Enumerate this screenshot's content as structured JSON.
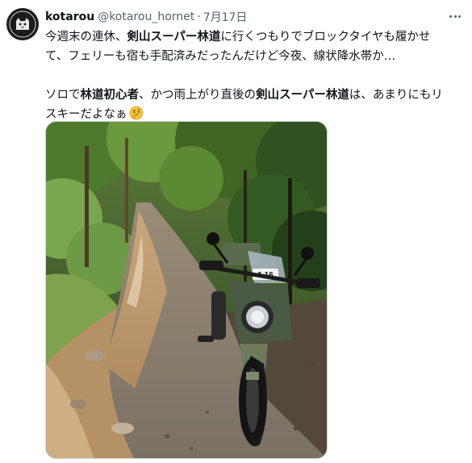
{
  "tweet": {
    "author_name": "kotarou",
    "handle": "@kotarou_hornet",
    "separator": "·",
    "date": "7月17日",
    "avatar_icon": "cat-logo-avatar",
    "more_icon": "more-options-icon",
    "paragraph1": {
      "l1a": "今週末の連休、",
      "l1b": "剣山スーパー林道",
      "l1c": "に行くつもりでブロックタイヤも履かせ",
      "l2": "て、フェリーも宿も手配済みだったんだけど今夜、線状降水帯か…"
    },
    "paragraph2": {
      "l1a": "ソロで",
      "l1b": "林道初心者",
      "l1c": "、かつ雨上がり直後の",
      "l1d": "剣山スーパー林道",
      "l1e": "は、あまりにもリ",
      "l2": "スキーだよなぁ"
    },
    "emoji": "thinking-face-emoji",
    "media": {
      "plate_text": "1 16"
    }
  },
  "colors": {
    "text": "#0f1419",
    "secondary": "#536471",
    "border": "#cfd9de"
  }
}
